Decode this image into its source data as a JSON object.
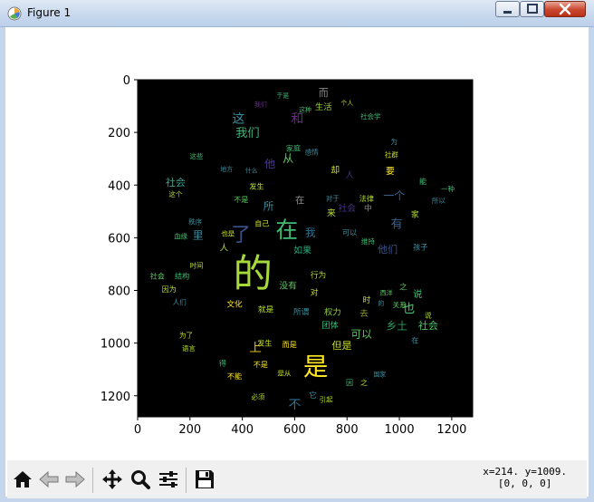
{
  "window": {
    "title": "Figure 1",
    "controls": {
      "minimize_icon": "minimize-icon",
      "maximize_icon": "maximize-icon",
      "close_icon": "close-icon"
    }
  },
  "toolbar": {
    "buttons": [
      {
        "name": "home-button",
        "icon": "home-icon"
      },
      {
        "name": "back-button",
        "icon": "back-arrow-icon"
      },
      {
        "name": "forward-button",
        "icon": "forward-arrow-icon"
      },
      {
        "name": "pan-button",
        "icon": "move-icon"
      },
      {
        "name": "zoom-button",
        "icon": "magnifier-icon"
      },
      {
        "name": "configure-subplots-button",
        "icon": "sliders-icon"
      },
      {
        "name": "save-button",
        "icon": "floppy-disk-icon"
      }
    ],
    "coordinate_readout": {
      "line1": "x=214. y=1009.",
      "line2": "[0, 0, 0]"
    }
  },
  "chart_data": {
    "type": "image",
    "xlim": [
      0,
      1280
    ],
    "ylim": [
      1280,
      0
    ],
    "xticks": [
      "0",
      "200",
      "400",
      "600",
      "800",
      "1000",
      "1200"
    ],
    "yticks": [
      "0",
      "200",
      "400",
      "600",
      "800",
      "1000",
      "1200"
    ],
    "background": "#000000",
    "words": [
      {
        "t": "的",
        "x": 440,
        "y": 740,
        "s": 150,
        "c": "#a6d93a"
      },
      {
        "t": "是",
        "x": 680,
        "y": 1090,
        "s": 95,
        "c": "#fde725"
      },
      {
        "t": "在",
        "x": 570,
        "y": 570,
        "s": 85,
        "c": "#3fbc73"
      },
      {
        "t": "了",
        "x": 395,
        "y": 590,
        "s": 75,
        "c": "#3b528b"
      },
      {
        "t": "这",
        "x": 385,
        "y": 150,
        "s": 48,
        "c": "#3b8ea0"
      },
      {
        "t": "和",
        "x": 610,
        "y": 150,
        "s": 48,
        "c": "#6b2a8a"
      },
      {
        "t": "我们",
        "x": 420,
        "y": 205,
        "s": 46,
        "c": "#3fae7a"
      },
      {
        "t": "他",
        "x": 505,
        "y": 320,
        "s": 42,
        "c": "#4a3a8f"
      },
      {
        "t": "从",
        "x": 575,
        "y": 300,
        "s": 42,
        "c": "#5ec962"
      },
      {
        "t": "而",
        "x": 710,
        "y": 50,
        "s": 38,
        "c": "#8a8a8a"
      },
      {
        "t": "生活",
        "x": 710,
        "y": 105,
        "s": 32,
        "c": "#9fd138"
      },
      {
        "t": "社会",
        "x": 145,
        "y": 390,
        "s": 38,
        "c": "#3e9f8c"
      },
      {
        "t": "一个",
        "x": 980,
        "y": 440,
        "s": 42,
        "c": "#355f8d"
      },
      {
        "t": "有",
        "x": 990,
        "y": 550,
        "s": 46,
        "c": "#35608d"
      },
      {
        "t": "也",
        "x": 1035,
        "y": 870,
        "s": 48,
        "c": "#4ec36b"
      },
      {
        "t": "乡土",
        "x": 990,
        "y": 935,
        "s": 40,
        "c": "#2d9e5c"
      },
      {
        "t": "社会",
        "x": 1110,
        "y": 935,
        "s": 38,
        "c": "#4ec36b"
      },
      {
        "t": "可以",
        "x": 855,
        "y": 965,
        "s": 40,
        "c": "#5ec962"
      },
      {
        "t": "但是",
        "x": 780,
        "y": 1010,
        "s": 38,
        "c": "#c8e020"
      },
      {
        "t": "上",
        "x": 450,
        "y": 1020,
        "s": 46,
        "c": "#e0c026"
      },
      {
        "t": "他们",
        "x": 955,
        "y": 645,
        "s": 38,
        "c": "#3b528b"
      },
      {
        "t": "如果",
        "x": 630,
        "y": 650,
        "s": 34,
        "c": "#28ae80"
      },
      {
        "t": "没有",
        "x": 575,
        "y": 785,
        "s": 34,
        "c": "#5ec962"
      },
      {
        "t": "所",
        "x": 500,
        "y": 480,
        "s": 40,
        "c": "#3b8ea0"
      },
      {
        "t": "我",
        "x": 660,
        "y": 580,
        "s": 40,
        "c": "#2d708e"
      },
      {
        "t": "里",
        "x": 230,
        "y": 590,
        "s": 40,
        "c": "#3b8ea0"
      },
      {
        "t": "人",
        "x": 330,
        "y": 640,
        "s": 32,
        "c": "#b5de2b"
      },
      {
        "t": "来",
        "x": 740,
        "y": 510,
        "s": 34,
        "c": "#b5de2b"
      },
      {
        "t": "社会",
        "x": 800,
        "y": 490,
        "s": 34,
        "c": "#46327e"
      },
      {
        "t": "中",
        "x": 880,
        "y": 490,
        "s": 30,
        "c": "#8a8a8a"
      },
      {
        "t": "说",
        "x": 1070,
        "y": 815,
        "s": 36,
        "c": "#3fbc73"
      },
      {
        "t": "去",
        "x": 865,
        "y": 890,
        "s": 32,
        "c": "#8f9e2a"
      },
      {
        "t": "不",
        "x": 600,
        "y": 1235,
        "s": 48,
        "c": "#2d708e"
      },
      {
        "t": "之",
        "x": 1015,
        "y": 790,
        "s": 30,
        "c": "#5ec962"
      },
      {
        "t": "权力",
        "x": 745,
        "y": 885,
        "s": 32,
        "c": "#8fcf43"
      },
      {
        "t": "团体",
        "x": 735,
        "y": 935,
        "s": 32,
        "c": "#35b779"
      },
      {
        "t": "行为",
        "x": 690,
        "y": 745,
        "s": 30,
        "c": "#b5de2b"
      },
      {
        "t": "对",
        "x": 675,
        "y": 810,
        "s": 30,
        "c": "#c8e020"
      },
      {
        "t": "所谓",
        "x": 625,
        "y": 885,
        "s": 30,
        "c": "#3b8ea0"
      },
      {
        "t": "就是",
        "x": 490,
        "y": 875,
        "s": 30,
        "c": "#b5de2b"
      },
      {
        "t": "文化",
        "x": 370,
        "y": 855,
        "s": 30,
        "c": "#fde725"
      },
      {
        "t": "结构",
        "x": 170,
        "y": 745,
        "s": 28,
        "c": "#3fbc73"
      },
      {
        "t": "社会",
        "x": 75,
        "y": 745,
        "s": 28,
        "c": "#5ec962"
      },
      {
        "t": "因为",
        "x": 120,
        "y": 795,
        "s": 28,
        "c": "#b5de2b"
      },
      {
        "t": "人们",
        "x": 160,
        "y": 845,
        "s": 26,
        "c": "#3b8ea0"
      },
      {
        "t": "时间",
        "x": 225,
        "y": 705,
        "s": 26,
        "c": "#b5de2b"
      },
      {
        "t": "血缘",
        "x": 165,
        "y": 595,
        "s": 26,
        "c": "#3fbc73"
      },
      {
        "t": "秩序",
        "x": 220,
        "y": 540,
        "s": 26,
        "c": "#3b8ea0"
      },
      {
        "t": "这个",
        "x": 145,
        "y": 435,
        "s": 26,
        "c": "#b5de2b"
      },
      {
        "t": "这些",
        "x": 225,
        "y": 290,
        "s": 26,
        "c": "#3fbc73"
      },
      {
        "t": "地方",
        "x": 340,
        "y": 340,
        "s": 24,
        "c": "#3b8ea0"
      },
      {
        "t": "什么",
        "x": 435,
        "y": 345,
        "s": 24,
        "c": "#3b8ea0"
      },
      {
        "t": "不是",
        "x": 395,
        "y": 455,
        "s": 28,
        "c": "#5ec962"
      },
      {
        "t": "发生",
        "x": 455,
        "y": 405,
        "s": 28,
        "c": "#b5de2b"
      },
      {
        "t": "家庭",
        "x": 595,
        "y": 260,
        "s": 28,
        "c": "#3fbc73"
      },
      {
        "t": "感情",
        "x": 665,
        "y": 275,
        "s": 26,
        "c": "#3b8ea0"
      },
      {
        "t": "却",
        "x": 755,
        "y": 345,
        "s": 34,
        "c": "#c8e020"
      },
      {
        "t": "人",
        "x": 810,
        "y": 365,
        "s": 34,
        "c": "#46327e"
      },
      {
        "t": "要",
        "x": 965,
        "y": 350,
        "s": 34,
        "c": "#fde725"
      },
      {
        "t": "社会学",
        "x": 890,
        "y": 140,
        "s": 26,
        "c": "#3fbc73"
      },
      {
        "t": "个人",
        "x": 800,
        "y": 90,
        "s": 24,
        "c": "#b5de2b"
      },
      {
        "t": "法律",
        "x": 875,
        "y": 450,
        "s": 28,
        "c": "#b5de2b"
      },
      {
        "t": "对于",
        "x": 745,
        "y": 450,
        "s": 26,
        "c": "#3b8ea0"
      },
      {
        "t": "可以",
        "x": 810,
        "y": 580,
        "s": 28,
        "c": "#3b8ea0"
      },
      {
        "t": "维持",
        "x": 880,
        "y": 615,
        "s": 26,
        "c": "#3fbc73"
      },
      {
        "t": "孩子",
        "x": 1080,
        "y": 635,
        "s": 28,
        "c": "#3b8ea0"
      },
      {
        "t": "家",
        "x": 1060,
        "y": 515,
        "s": 30,
        "c": "#b5de2b"
      },
      {
        "t": "一种",
        "x": 1185,
        "y": 415,
        "s": 26,
        "c": "#3fbc73"
      },
      {
        "t": "所以",
        "x": 1150,
        "y": 460,
        "s": 26,
        "c": "#3b8ea0"
      },
      {
        "t": "能",
        "x": 1090,
        "y": 385,
        "s": 28,
        "c": "#3fbc73"
      },
      {
        "t": "社群",
        "x": 970,
        "y": 285,
        "s": 26,
        "c": "#c8e020"
      },
      {
        "t": "为",
        "x": 980,
        "y": 235,
        "s": 26,
        "c": "#3b8ea0"
      },
      {
        "t": "时",
        "x": 875,
        "y": 840,
        "s": 30,
        "c": "#c8e020"
      },
      {
        "t": "的",
        "x": 930,
        "y": 850,
        "s": 24,
        "c": "#3b8ea0"
      },
      {
        "t": "关系",
        "x": 1000,
        "y": 855,
        "s": 26,
        "c": "#5ec962"
      },
      {
        "t": "说",
        "x": 1110,
        "y": 895,
        "s": 26,
        "c": "#b5de2b"
      },
      {
        "t": "在",
        "x": 1060,
        "y": 990,
        "s": 28,
        "c": "#3b8ea0"
      },
      {
        "t": "西洋",
        "x": 950,
        "y": 810,
        "s": 24,
        "c": "#5ec962"
      },
      {
        "t": "国家",
        "x": 925,
        "y": 1120,
        "s": 24,
        "c": "#3b8ea0"
      },
      {
        "t": "因",
        "x": 810,
        "y": 1150,
        "s": 28,
        "c": "#3fbc73"
      },
      {
        "t": "之",
        "x": 865,
        "y": 1150,
        "s": 28,
        "c": "#b5de2b"
      },
      {
        "t": "而是",
        "x": 580,
        "y": 1005,
        "s": 28,
        "c": "#fde725"
      },
      {
        "t": "发生",
        "x": 485,
        "y": 1000,
        "s": 28,
        "c": "#c8e020"
      },
      {
        "t": "不是",
        "x": 470,
        "y": 1080,
        "s": 28,
        "c": "#fde725"
      },
      {
        "t": "不能",
        "x": 370,
        "y": 1125,
        "s": 28,
        "c": "#fde725"
      },
      {
        "t": "是从",
        "x": 560,
        "y": 1115,
        "s": 26,
        "c": "#c8e020"
      },
      {
        "t": "得",
        "x": 325,
        "y": 1075,
        "s": 28,
        "c": "#3fbc73"
      },
      {
        "t": "语言",
        "x": 195,
        "y": 1020,
        "s": 26,
        "c": "#b5de2b"
      },
      {
        "t": "为了",
        "x": 185,
        "y": 970,
        "s": 26,
        "c": "#c8e020"
      },
      {
        "t": "必须",
        "x": 460,
        "y": 1205,
        "s": 26,
        "c": "#b5de2b"
      },
      {
        "t": "引起",
        "x": 720,
        "y": 1215,
        "s": 26,
        "c": "#b5de2b"
      },
      {
        "t": "它",
        "x": 670,
        "y": 1200,
        "s": 30,
        "c": "#3b8ea0"
      },
      {
        "t": "自己",
        "x": 475,
        "y": 545,
        "s": 28,
        "c": "#c8e020"
      },
      {
        "t": "也是",
        "x": 345,
        "y": 585,
        "s": 26,
        "c": "#c8e020"
      },
      {
        "t": "在",
        "x": 620,
        "y": 460,
        "s": 36,
        "c": "#8a8a8a"
      },
      {
        "t": "于是",
        "x": 555,
        "y": 60,
        "s": 24,
        "c": "#3fbc73"
      },
      {
        "t": "这种",
        "x": 640,
        "y": 115,
        "s": 24,
        "c": "#3fbc73"
      },
      {
        "t": "我们",
        "x": 470,
        "y": 95,
        "s": 24,
        "c": "#6b2a8a"
      }
    ]
  }
}
